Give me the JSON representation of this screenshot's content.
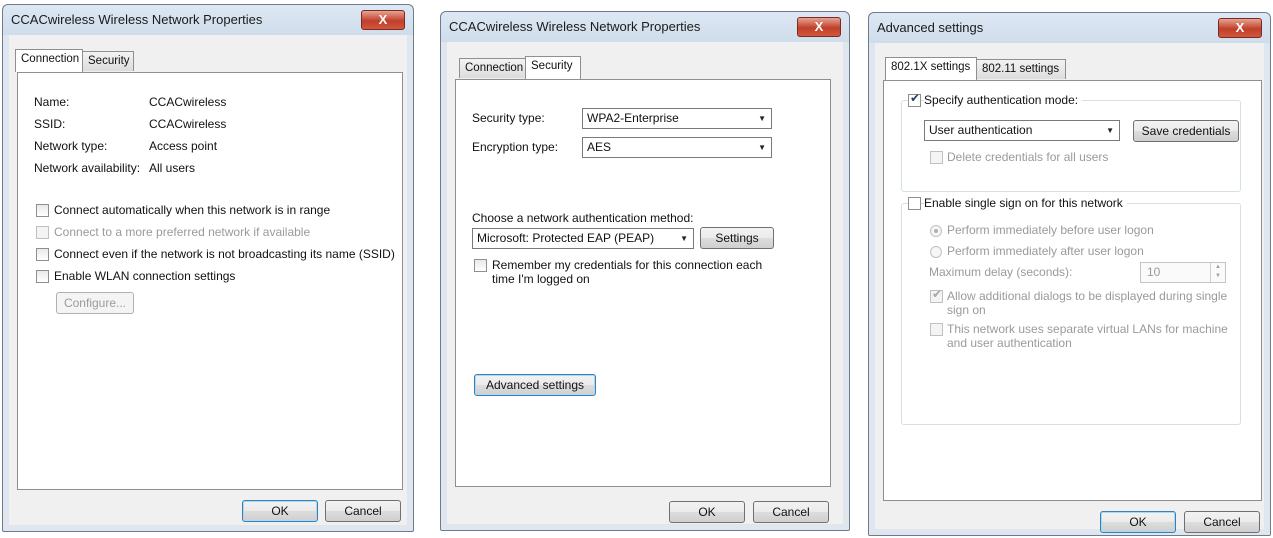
{
  "dialog1": {
    "title": "CCACwireless Wireless Network Properties",
    "close_label": "X",
    "tabs": [
      "Connection",
      "Security"
    ],
    "fields": [
      {
        "label": "Name:",
        "value": "CCACwireless"
      },
      {
        "label": "SSID:",
        "value": "CCACwireless"
      },
      {
        "label": "Network type:",
        "value": "Access point"
      },
      {
        "label": "Network availability:",
        "value": "All users"
      }
    ],
    "options": [
      {
        "label": "Connect automatically when this network is in range",
        "checked": false,
        "enabled": true
      },
      {
        "label": "Connect to a more preferred network if available",
        "checked": false,
        "enabled": false
      },
      {
        "label": "Connect even if the network is not broadcasting its name (SSID)",
        "checked": false,
        "enabled": true
      },
      {
        "label": "Enable WLAN connection settings",
        "checked": false,
        "enabled": true
      }
    ],
    "configure_label": "Configure...",
    "ok_label": "OK",
    "cancel_label": "Cancel"
  },
  "dialog2": {
    "title": "CCACwireless Wireless Network Properties",
    "close_label": "X",
    "tabs": [
      "Connection",
      "Security"
    ],
    "security_type_label": "Security type:",
    "security_type_value": "WPA2-Enterprise",
    "encryption_type_label": "Encryption type:",
    "encryption_type_value": "AES",
    "auth_method_label": "Choose a network authentication method:",
    "auth_method_value": "Microsoft: Protected EAP (PEAP)",
    "settings_label": "Settings",
    "remember_line1": "Remember my credentials for this connection each",
    "remember_line2": "time I'm logged on",
    "advanced_label": "Advanced settings",
    "ok_label": "OK",
    "cancel_label": "Cancel"
  },
  "dialog3": {
    "title": "Advanced settings",
    "close_label": "X",
    "tabs": [
      "802.1X settings",
      "802.11 settings"
    ],
    "specify_auth_label": "Specify authentication mode:",
    "auth_mode_value": "User authentication",
    "save_credentials_label": "Save credentials",
    "delete_credentials_label": "Delete credentials for all users",
    "sso_label": "Enable single sign on for this network",
    "before_logon_label": "Perform immediately before user logon",
    "after_logon_label": "Perform immediately after user logon",
    "max_delay_label": "Maximum delay (seconds):",
    "max_delay_value": "10",
    "allow_dialogs_line1": "Allow additional dialogs to be displayed during single",
    "allow_dialogs_line2": "sign on",
    "vlan_line1": "This network uses separate virtual LANs for machine",
    "vlan_line2": "and user authentication",
    "ok_label": "OK",
    "cancel_label": "Cancel"
  }
}
